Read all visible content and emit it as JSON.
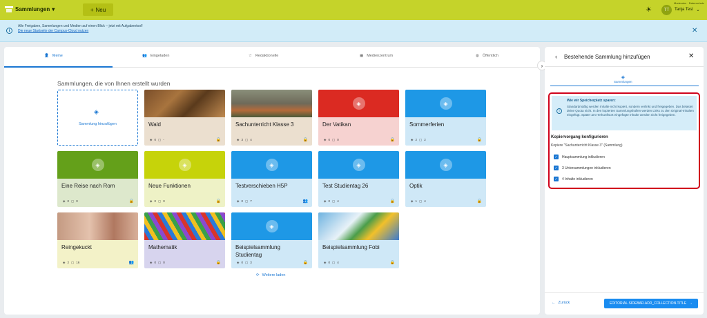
{
  "topbar": {
    "app_menu_label": "Sammlungen",
    "new_button_label": "Neu",
    "user_sub": "Moderator · Datenschutz",
    "user_initials": "TT",
    "user_name": "Tanja Test",
    "bg_color": "#c5d32a"
  },
  "banner": {
    "line1": "Alle Freigaben, Sammlungen und Medien auf einen Blick – jetzt mit Aufgabentool!",
    "line2": "Die neue Startseite der Campus-Cloud nutzen"
  },
  "tabs": [
    {
      "label": "Meine",
      "icon": "person-icon",
      "active": true
    },
    {
      "label": "Eingeladen",
      "icon": "people-icon",
      "active": false
    },
    {
      "label": "Redaktionelle",
      "icon": "star-icon",
      "active": false
    },
    {
      "label": "Medienzentrum",
      "icon": "building-icon",
      "active": false
    },
    {
      "label": "Öffentlich",
      "icon": "globe-icon",
      "active": false
    }
  ],
  "section_title": "Sammlungen, die von Ihnen erstellt wurden",
  "add_card_label": "Sammlung hinzufügen",
  "cards": [
    {
      "title": "Wald",
      "m1": "0",
      "m2": "-"
    },
    {
      "title": "Sachunterricht Klasse 3",
      "m1": "3",
      "m2": "4"
    },
    {
      "title": "Der Vatikan",
      "m1": "0",
      "m2": "0"
    },
    {
      "title": "Sommerferien",
      "m1": "2",
      "m2": "2"
    },
    {
      "title": "Eine Reise nach Rom",
      "m1": "0",
      "m2": "0"
    },
    {
      "title": "Neue Funktionen",
      "m1": "0",
      "m2": "0"
    },
    {
      "title": "Testverschieben H5P",
      "m1": "0",
      "m2": "7"
    },
    {
      "title": "Test Studientag 26",
      "m1": "0",
      "m2": "4"
    },
    {
      "title": "Optik",
      "m1": "1",
      "m2": "4"
    },
    {
      "title": "Reingekuckt",
      "m1": "2",
      "m2": "16"
    },
    {
      "title": "Mathematik",
      "m1": "0",
      "m2": "0"
    },
    {
      "title": "Beispielsammlung Studientag",
      "m1": "0",
      "m2": "3"
    },
    {
      "title": "Beispielsammlung Fobi",
      "m1": "0",
      "m2": "4"
    }
  ],
  "load_more": "Weitere laden",
  "sidebar": {
    "title": "Bestehende Sammlung hinzufügen",
    "tab_label": "Sammlungen",
    "notice_heading": "Wie wir Speicherplatz sparen:",
    "notice_body": "Standardmäßig werden Inhalte nicht kopiert, sondern verlinkt und freigegeben. Das belastet deine Quota nicht. In den kopierten Sammlungshüllen werden Links zu den Original-Inhalten eingefügt. Später am Herkunftsort eingefügte Inhalte werden nicht freigegeben.",
    "config_title": "Kopiervorgang konfigurieren",
    "config_sub": "Kopiere \"Sachunterricht Klasse 3\" (Sammlung)",
    "checks": [
      "Hauptsammlung inkludieren",
      "3 Untersammlungen inkludieren",
      "4 Inhalte inkludieren"
    ],
    "back_label": "Zurück",
    "primary_label": "EDITORIAL.SIDEBAR.ADD_COLLECTION.TITLE"
  }
}
